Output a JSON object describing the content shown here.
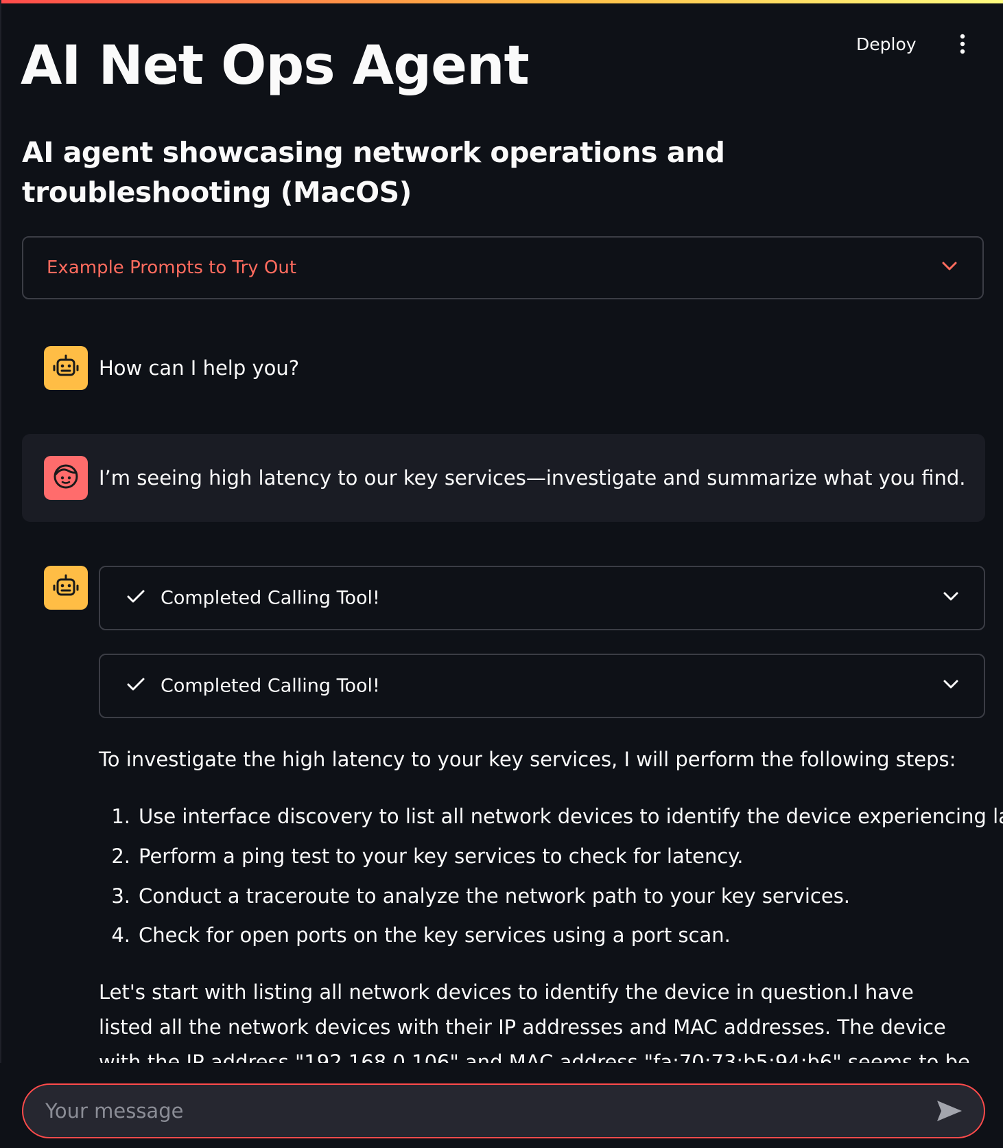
{
  "header": {
    "deploy_label": "Deploy",
    "menu_icon": "more-vertical-icon"
  },
  "page": {
    "title": "AI Net Ops Agent",
    "subtitle": "AI agent showcasing network operations and troubleshooting (MacOS)"
  },
  "expander": {
    "label": "Example Prompts to Try Out",
    "icon": "chevron-down-icon"
  },
  "chat": {
    "assistant_greeting": "How can I help you?",
    "user_message": "I’m seeing high latency to our key services—investigate and summarize what you find.",
    "tool_status": [
      {
        "label": "Completed Calling Tool!"
      },
      {
        "label": "Completed Calling Tool!"
      }
    ],
    "response": {
      "intro": "To investigate the high latency to your key services, I will perform the following steps:",
      "steps": [
        {
          "num": "1.",
          "text": "Use interface discovery to list all network devices to identify the device experiencing latency."
        },
        {
          "num": "2.",
          "text": "Perform a ping test to your key services to check for latency."
        },
        {
          "num": "3.",
          "text": "Conduct a traceroute to analyze the network path to your key services."
        },
        {
          "num": "4.",
          "text": "Check for open ports on the key services using a port scan."
        }
      ],
      "followup": "Let's start with listing all network devices to identify the device in question.I have listed all the network devices with their IP addresses and MAC addresses. The device with the IP address \"192.168.0.106\" and MAC address \"fa:70:73:b5:94:b6\" seems to be your local device. Next, I will"
    }
  },
  "input": {
    "placeholder": "Your message",
    "value": ""
  },
  "colors": {
    "accent": "#ff4b4b",
    "bot_avatar": "#ffbd45",
    "user_avatar": "#ff6c6c",
    "background": "#0e1117"
  }
}
